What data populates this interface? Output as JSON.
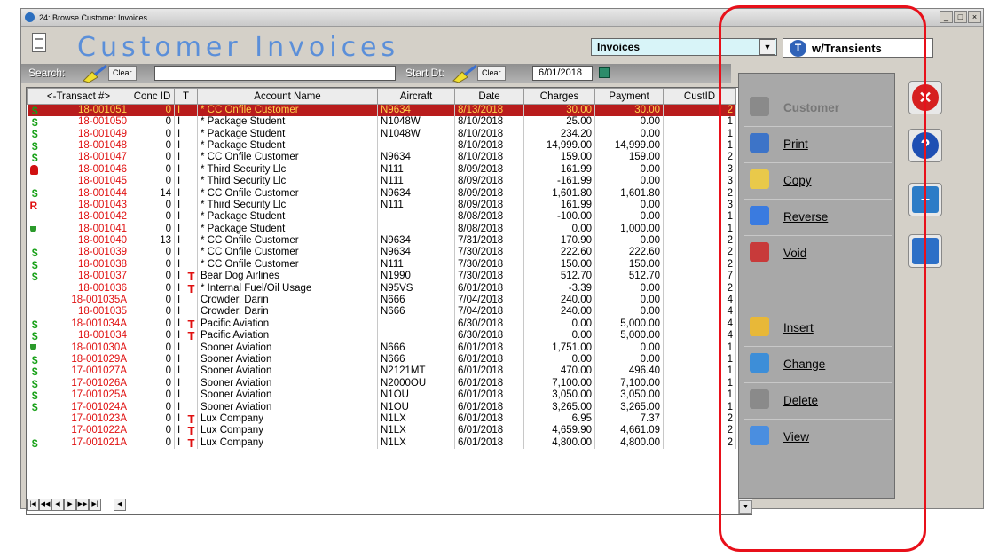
{
  "window": {
    "title": "24: Browse Customer Invoices",
    "controls": [
      "_",
      "□",
      "×"
    ]
  },
  "header": {
    "title": "Customer Invoices"
  },
  "toolbar": {
    "search_label": "Search:",
    "clear_label": "Clear",
    "start_label": "Start Dt:",
    "start_clear_label": "Clear",
    "start_date": "6/01/2018"
  },
  "type_select": {
    "value": "Invoices",
    "arrow": "▼"
  },
  "transients": {
    "icon_letter": "T",
    "label": "w/Transients"
  },
  "grid": {
    "columns": [
      "<-Transact #>",
      "Conc ID",
      "T",
      "",
      "Account Name",
      "Aircraft",
      "Date",
      "Charges",
      "Payment",
      "CustID"
    ],
    "rows": [
      {
        "icon": "dollar",
        "tx": "18-001051",
        "conc": "0",
        "t": "I",
        "flag": "",
        "acct": "* CC Onfile Customer",
        "ac": "N9634",
        "date": "8/13/2018",
        "chg": "30.00",
        "pay": "30.00",
        "cust": "2",
        "sel": true
      },
      {
        "icon": "dollar",
        "tx": "18-001050",
        "conc": "0",
        "t": "I",
        "flag": "",
        "acct": "* Package Student",
        "ac": "N1048W",
        "date": "8/10/2018",
        "chg": "25.00",
        "pay": "0.00",
        "cust": "1"
      },
      {
        "icon": "dollar",
        "tx": "18-001049",
        "conc": "0",
        "t": "I",
        "flag": "",
        "acct": "* Package Student",
        "ac": "N1048W",
        "date": "8/10/2018",
        "chg": "234.20",
        "pay": "0.00",
        "cust": "1"
      },
      {
        "icon": "dollar",
        "tx": "18-001048",
        "conc": "0",
        "t": "I",
        "flag": "",
        "acct": "* Package Student",
        "ac": "",
        "date": "8/10/2018",
        "chg": "14,999.00",
        "pay": "14,999.00",
        "cust": "1"
      },
      {
        "icon": "dollar",
        "tx": "18-001047",
        "conc": "0",
        "t": "I",
        "flag": "",
        "acct": "* CC Onfile Customer",
        "ac": "N9634",
        "date": "8/10/2018",
        "chg": "159.00",
        "pay": "159.00",
        "cust": "2"
      },
      {
        "icon": "hand",
        "tx": "18-001046",
        "conc": "0",
        "t": "I",
        "flag": "",
        "acct": "* Third Security Llc",
        "ac": "N111",
        "date": "8/09/2018",
        "chg": "161.99",
        "pay": "0.00",
        "cust": "3"
      },
      {
        "icon": "",
        "tx": "18-001045",
        "conc": "0",
        "t": "I",
        "flag": "",
        "acct": "* Third Security Llc",
        "ac": "N111",
        "date": "8/09/2018",
        "chg": "-161.99",
        "pay": "0.00",
        "cust": "3"
      },
      {
        "icon": "dollar",
        "tx": "18-001044",
        "conc": "14",
        "t": "I",
        "flag": "",
        "acct": "* CC Onfile Customer",
        "ac": "N9634",
        "date": "8/09/2018",
        "chg": "1,601.80",
        "pay": "1,601.80",
        "cust": "2"
      },
      {
        "icon": "R",
        "tx": "18-001043",
        "conc": "0",
        "t": "I",
        "flag": "",
        "acct": "* Third Security Llc",
        "ac": "N111",
        "date": "8/09/2018",
        "chg": "161.99",
        "pay": "0.00",
        "cust": "3"
      },
      {
        "icon": "",
        "tx": "18-001042",
        "conc": "0",
        "t": "I",
        "flag": "",
        "acct": "* Package Student",
        "ac": "",
        "date": "8/08/2018",
        "chg": "-100.00",
        "pay": "0.00",
        "cust": "1"
      },
      {
        "icon": "shield",
        "tx": "18-001041",
        "conc": "0",
        "t": "I",
        "flag": "",
        "acct": "* Package Student",
        "ac": "",
        "date": "8/08/2018",
        "chg": "0.00",
        "pay": "1,000.00",
        "cust": "1"
      },
      {
        "icon": "",
        "tx": "18-001040",
        "conc": "13",
        "t": "I",
        "flag": "",
        "acct": "* CC Onfile Customer",
        "ac": "N9634",
        "date": "7/31/2018",
        "chg": "170.90",
        "pay": "0.00",
        "cust": "2"
      },
      {
        "icon": "dollar",
        "tx": "18-001039",
        "conc": "0",
        "t": "I",
        "flag": "",
        "acct": "* CC Onfile Customer",
        "ac": "N9634",
        "date": "7/30/2018",
        "chg": "222.60",
        "pay": "222.60",
        "cust": "2"
      },
      {
        "icon": "dollar",
        "tx": "18-001038",
        "conc": "0",
        "t": "I",
        "flag": "",
        "acct": "* CC Onfile Customer",
        "ac": "N111",
        "date": "7/30/2018",
        "chg": "150.00",
        "pay": "150.00",
        "cust": "2"
      },
      {
        "icon": "dollar",
        "tx": "18-001037",
        "conc": "0",
        "t": "I",
        "flag": "T",
        "acct": "Bear Dog Airlines",
        "ac": "N1990",
        "date": "7/30/2018",
        "chg": "512.70",
        "pay": "512.70",
        "cust": "7"
      },
      {
        "icon": "",
        "tx": "18-001036",
        "conc": "0",
        "t": "I",
        "flag": "T",
        "acct": "* Internal Fuel/Oil Usage",
        "ac": "N95VS",
        "date": "6/01/2018",
        "chg": "-3.39",
        "pay": "0.00",
        "cust": "2"
      },
      {
        "icon": "",
        "tx": "18-001035A",
        "conc": "0",
        "t": "I",
        "flag": "",
        "acct": "Crowder, Darin",
        "ac": "N666",
        "date": "7/04/2018",
        "chg": "240.00",
        "pay": "0.00",
        "cust": "4"
      },
      {
        "icon": "",
        "tx": "18-001035",
        "conc": "0",
        "t": "I",
        "flag": "",
        "acct": "Crowder, Darin",
        "ac": "N666",
        "date": "7/04/2018",
        "chg": "240.00",
        "pay": "0.00",
        "cust": "4"
      },
      {
        "icon": "dollar",
        "tx": "18-001034A",
        "conc": "0",
        "t": "I",
        "flag": "T",
        "acct": "Pacific Aviation",
        "ac": "",
        "date": "6/30/2018",
        "chg": "0.00",
        "pay": "5,000.00",
        "cust": "4"
      },
      {
        "icon": "dollar",
        "tx": "18-001034",
        "conc": "0",
        "t": "I",
        "flag": "T",
        "acct": "Pacific Aviation",
        "ac": "",
        "date": "6/30/2018",
        "chg": "0.00",
        "pay": "5,000.00",
        "cust": "4"
      },
      {
        "icon": "shield",
        "tx": "18-001030A",
        "conc": "0",
        "t": "I",
        "flag": "",
        "acct": "Sooner Aviation",
        "ac": "N666",
        "date": "6/01/2018",
        "chg": "1,751.00",
        "pay": "0.00",
        "cust": "1"
      },
      {
        "icon": "dollar",
        "tx": "18-001029A",
        "conc": "0",
        "t": "I",
        "flag": "",
        "acct": "Sooner Aviation",
        "ac": "N666",
        "date": "6/01/2018",
        "chg": "0.00",
        "pay": "0.00",
        "cust": "1"
      },
      {
        "icon": "dollar",
        "tx": "17-001027A",
        "conc": "0",
        "t": "I",
        "flag": "",
        "acct": "Sooner Aviation",
        "ac": "N2121MT",
        "date": "6/01/2018",
        "chg": "470.00",
        "pay": "496.40",
        "cust": "1"
      },
      {
        "icon": "dollar",
        "tx": "17-001026A",
        "conc": "0",
        "t": "I",
        "flag": "",
        "acct": "Sooner Aviation",
        "ac": "N2000OU",
        "date": "6/01/2018",
        "chg": "7,100.00",
        "pay": "7,100.00",
        "cust": "1"
      },
      {
        "icon": "dollar",
        "tx": "17-001025A",
        "conc": "0",
        "t": "I",
        "flag": "",
        "acct": "Sooner Aviation",
        "ac": "N1OU",
        "date": "6/01/2018",
        "chg": "3,050.00",
        "pay": "3,050.00",
        "cust": "1"
      },
      {
        "icon": "dollar",
        "tx": "17-001024A",
        "conc": "0",
        "t": "I",
        "flag": "",
        "acct": "Sooner Aviation",
        "ac": "N1OU",
        "date": "6/01/2018",
        "chg": "3,265.00",
        "pay": "3,265.00",
        "cust": "1"
      },
      {
        "icon": "",
        "tx": "17-001023A",
        "conc": "0",
        "t": "I",
        "flag": "T",
        "acct": "Lux Company",
        "ac": "N1LX",
        "date": "6/01/2018",
        "chg": "6.95",
        "pay": "7.37",
        "cust": "2"
      },
      {
        "icon": "",
        "tx": "17-001022A",
        "conc": "0",
        "t": "I",
        "flag": "T",
        "acct": "Lux Company",
        "ac": "N1LX",
        "date": "6/01/2018",
        "chg": "4,659.90",
        "pay": "4,661.09",
        "cust": "2"
      },
      {
        "icon": "dollar",
        "tx": "17-001021A",
        "conc": "0",
        "t": "I",
        "flag": "T",
        "acct": "Lux Company",
        "ac": "N1LX",
        "date": "6/01/2018",
        "chg": "4,800.00",
        "pay": "4,800.00",
        "cust": "2"
      }
    ],
    "nav": [
      "|◀",
      "◀◀",
      "◀",
      "▶",
      "▶▶",
      "▶|",
      "◀"
    ]
  },
  "actions": [
    {
      "label": "Customer",
      "icon": "customer-icon",
      "enabled": false
    },
    {
      "label": "Print",
      "icon": "printer-icon",
      "enabled": true
    },
    {
      "label": "Copy",
      "icon": "copy-icon",
      "enabled": true
    },
    {
      "label": "Reverse",
      "icon": "reverse-icon",
      "enabled": true
    },
    {
      "label": "Void",
      "icon": "void-icon",
      "enabled": true
    },
    {
      "label": "Insert",
      "icon": "insert-icon",
      "enabled": true
    },
    {
      "label": "Change",
      "icon": "change-icon",
      "enabled": true
    },
    {
      "label": "Delete",
      "icon": "delete-icon",
      "enabled": true
    },
    {
      "label": "View",
      "icon": "view-icon",
      "enabled": true
    }
  ],
  "side_buttons": [
    {
      "name": "close-circle-icon",
      "color": "#d62020"
    },
    {
      "name": "help-icon",
      "color": "#1e4fb3"
    },
    {
      "name": "add-list-icon",
      "color": "#2c7cc7"
    },
    {
      "name": "window-icon",
      "color": "#2c6fc7"
    }
  ],
  "colors": {
    "accent": "#5b8fd9",
    "selected_row": "#b81c1c",
    "transact": "#e01010",
    "annotation": "#e8101a"
  }
}
